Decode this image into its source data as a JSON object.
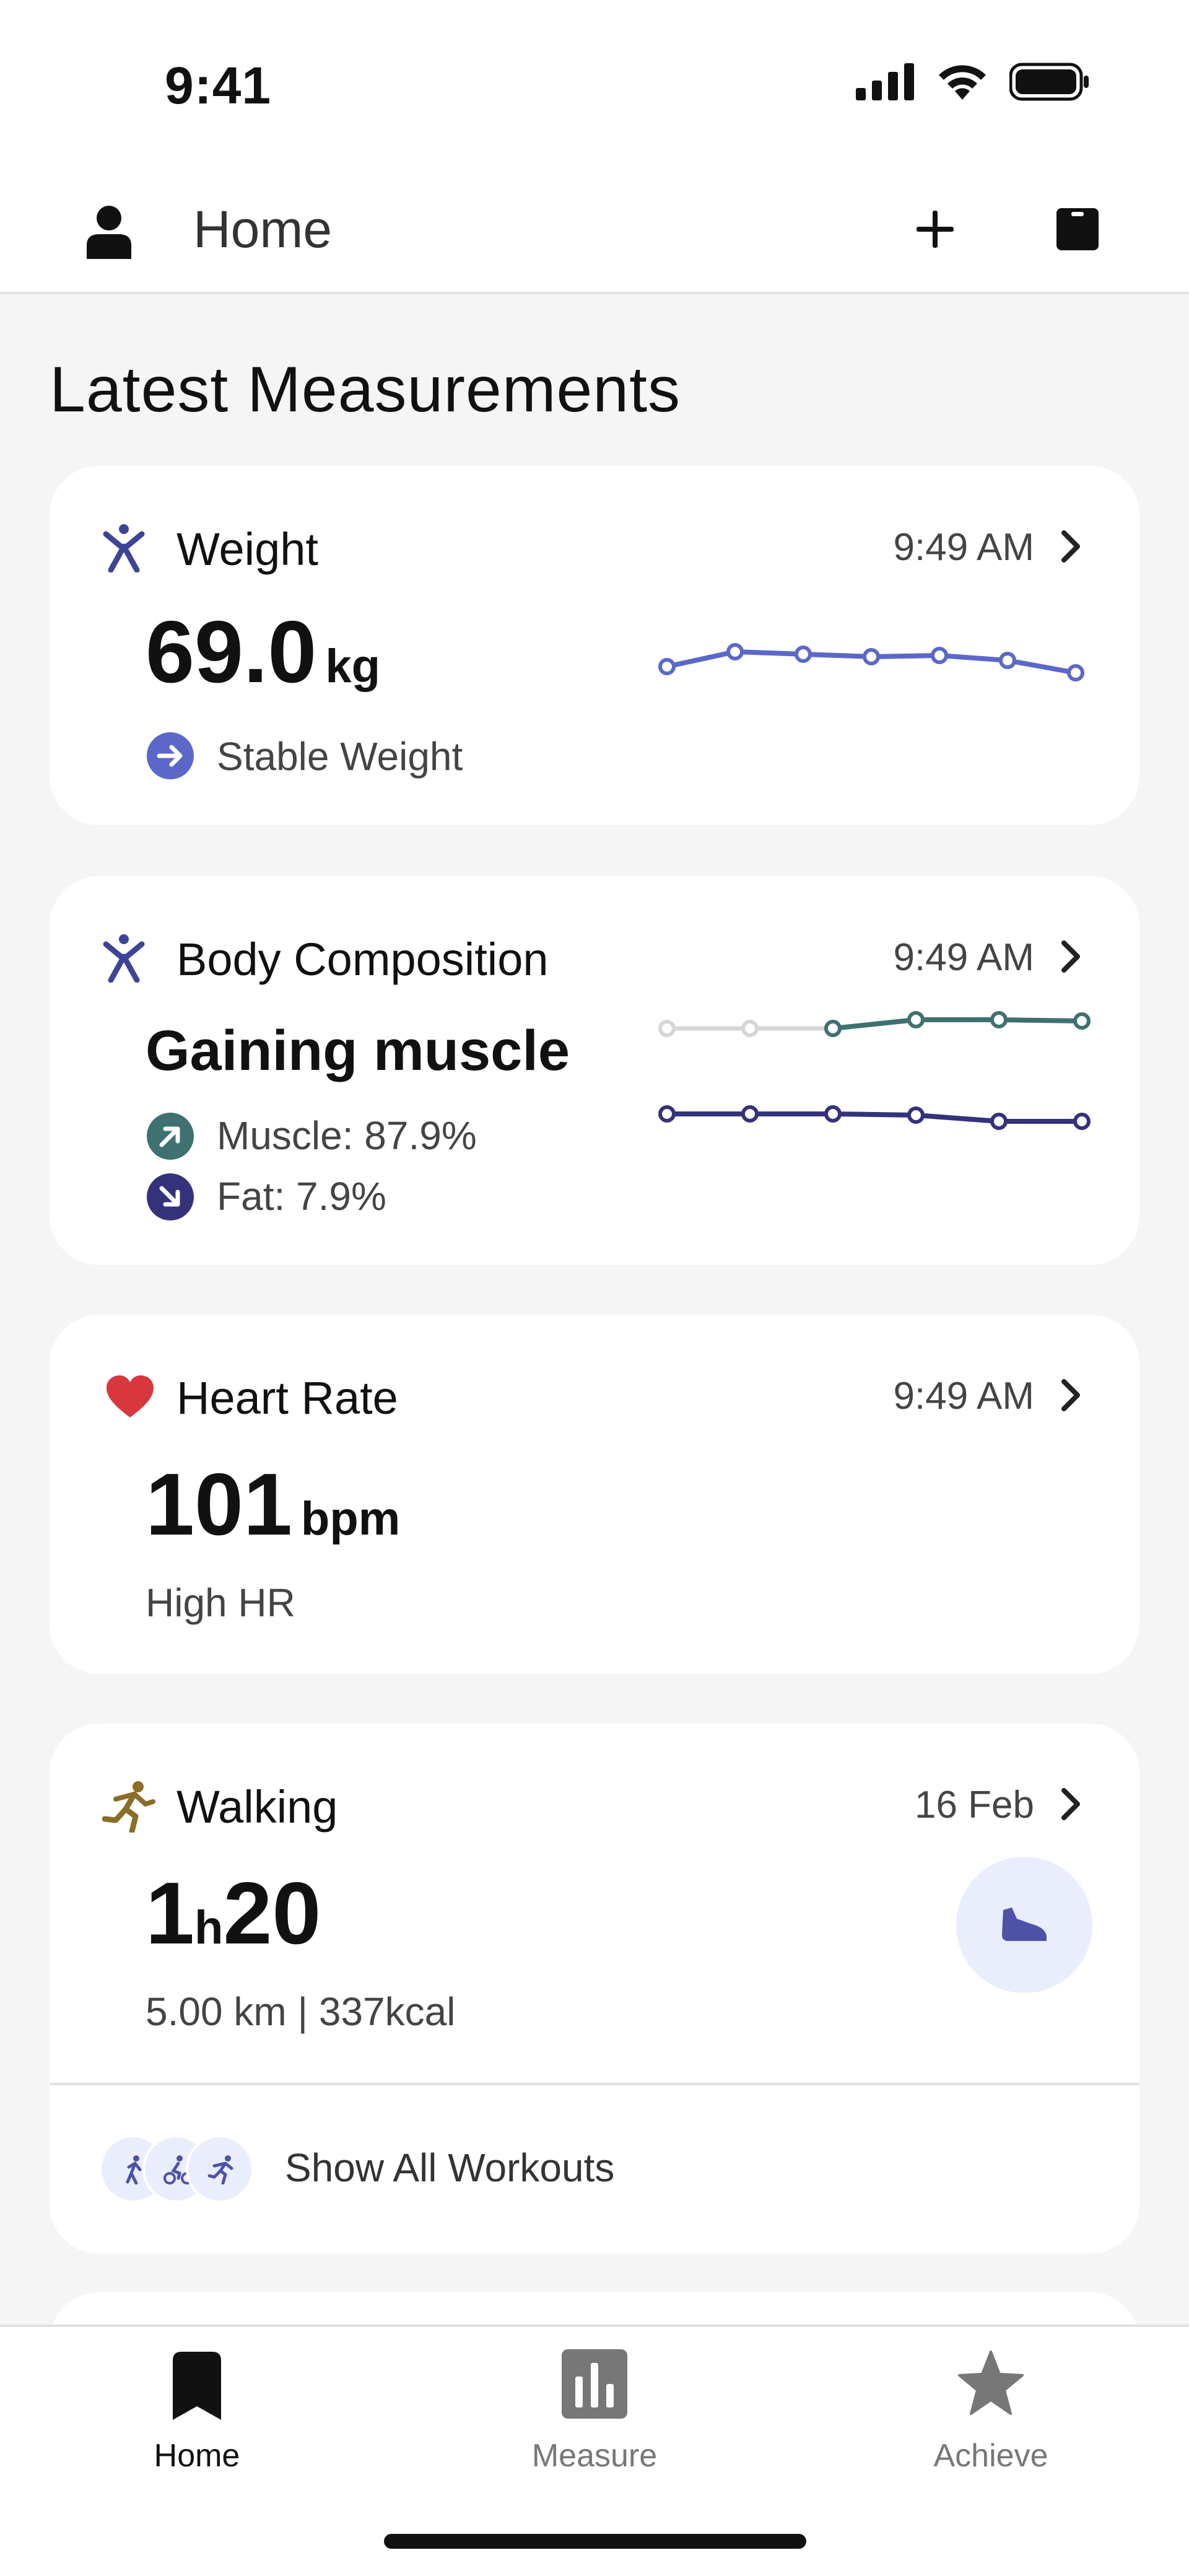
{
  "status_bar": {
    "time": "9:41"
  },
  "header": {
    "title": "Home"
  },
  "section_title": "Latest Measurements",
  "cards": {
    "weight": {
      "title": "Weight",
      "time": "9:49 AM",
      "value": "69.0",
      "unit": "kg",
      "status": "Stable Weight"
    },
    "body_composition": {
      "title": "Body Composition",
      "time": "9:49 AM",
      "headline": "Gaining muscle",
      "muscle": "Muscle: 87.9%",
      "fat": "Fat: 7.9%"
    },
    "heart_rate": {
      "title": "Heart Rate",
      "time": "9:49 AM",
      "value": "101",
      "unit": "bpm",
      "status": "High HR"
    },
    "walking": {
      "title": "Walking",
      "date": "16 Feb",
      "hours": "1",
      "h_unit": "h",
      "minutes": "20",
      "details": "5.00 km | 337kcal",
      "show_all": "Show All Workouts"
    }
  },
  "tabbar": {
    "home": "Home",
    "measure": "Measure",
    "achieve": "Achieve"
  },
  "colors": {
    "weight_line": "#5b68c9",
    "muscle_line": "#3e7170",
    "fat_line": "#34327a",
    "heart": "#d8373e",
    "walk_icon": "#8b6d2a",
    "accent_bg": "#eaedfc"
  }
}
